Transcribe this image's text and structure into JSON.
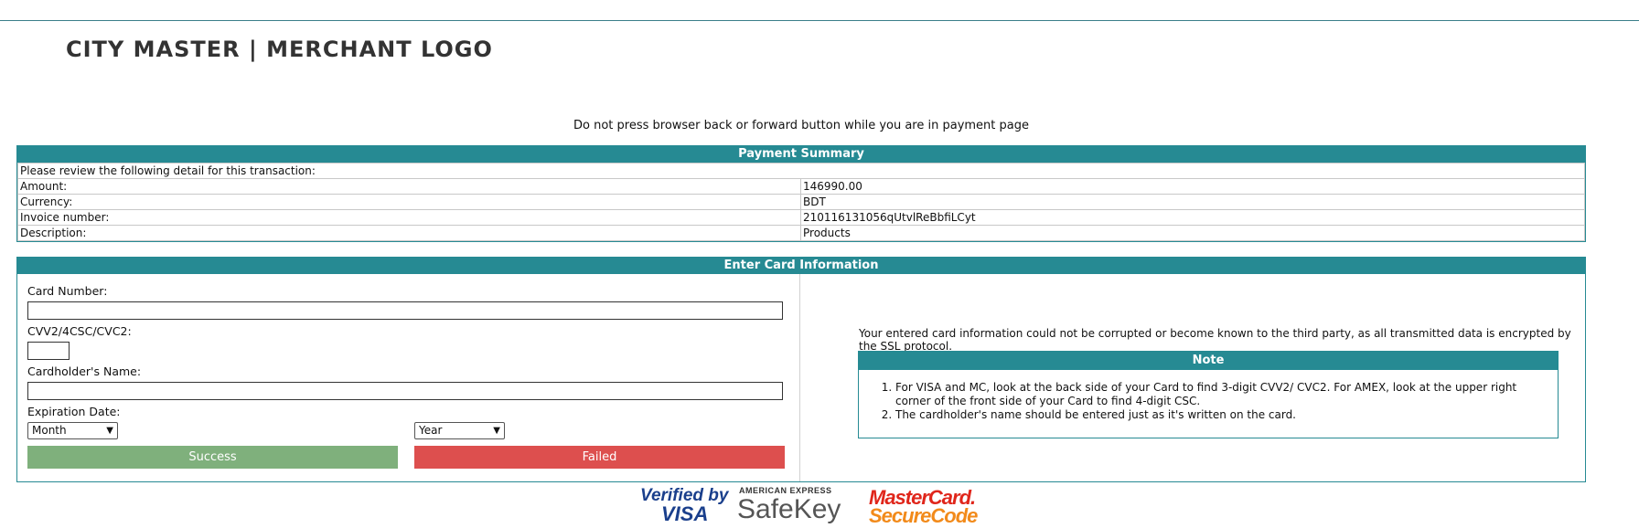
{
  "header": {
    "brand": "CITY MASTER | MERCHANT LOGO",
    "warning": "Do not press browser back or forward button while you are in payment page"
  },
  "summary": {
    "title": "Payment Summary",
    "intro": "Please review the following detail for this transaction:",
    "rows": [
      {
        "label": "Amount:",
        "value": "146990.00"
      },
      {
        "label": "Currency:",
        "value": "BDT"
      },
      {
        "label": "Invoice number:",
        "value": "210116131056qUtvlReBbfiLCyt"
      },
      {
        "label": "Description:",
        "value": "Products"
      }
    ]
  },
  "card_form": {
    "title": "Enter Card Information",
    "card_number_label": "Card Number:",
    "card_number_value": "",
    "cvv_label": "CVV2/4CSC/CVC2:",
    "cvv_value": "",
    "holder_label": "Cardholder's Name:",
    "holder_value": "",
    "expiration_label": "Expiration Date:",
    "month_selected": "Month",
    "year_selected": "Year",
    "success_label": "Success",
    "failed_label": "Failed"
  },
  "security": {
    "message": "Your entered card information could not be corrupted or become known to the third party, as all transmitted data is encrypted by the SSL protocol.",
    "note_title": "Note",
    "notes": [
      "For VISA and MC, look at the back side of your Card to find 3-digit CVV2/ CVC2. For AMEX, look at the upper right corner of the front side of your Card to find 4-digit CSC.",
      "The cardholder's name should be entered just as it's written on the card."
    ]
  },
  "badges": {
    "visa_line1": "Verified by",
    "visa_line2": "VISA",
    "amex_line1": "AMERICAN EXPRESS",
    "amex_line2": "SafeKey",
    "mc_line1": "MasterCard.",
    "mc_line2": "SecureCode"
  },
  "colors": {
    "accent": "#268a93",
    "success": "#7fb07c",
    "failed": "#dd4f4e"
  }
}
